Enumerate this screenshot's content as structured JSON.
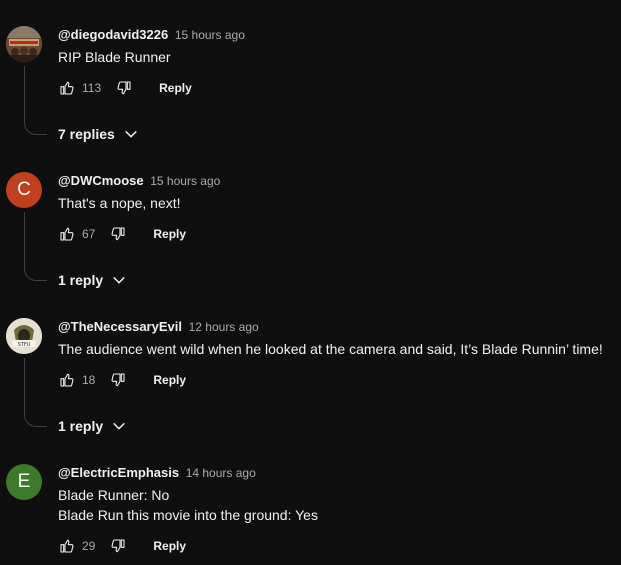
{
  "comments": [
    {
      "author": "@diegodavid3226",
      "time": "15 hours ago",
      "text_lines": [
        "RIP Blade Runner"
      ],
      "likes": "113",
      "reply_label": "Reply",
      "replies_label": "7 replies",
      "avatar_type": "image",
      "avatar_letter": ""
    },
    {
      "author": "@DWCmoose",
      "time": "15 hours ago",
      "text_lines": [
        "That's a nope, next!"
      ],
      "likes": "67",
      "reply_label": "Reply",
      "replies_label": "1 reply",
      "avatar_type": "letter",
      "avatar_letter": "C",
      "avatar_color": "#c0401f"
    },
    {
      "author": "@TheNecessaryEvil",
      "time": "12 hours ago",
      "text_lines": [
        "The audience went wild when he looked at the camera and said, It’s Blade Runnin’ time!"
      ],
      "likes": "18",
      "reply_label": "Reply",
      "replies_label": "1 reply",
      "avatar_type": "image",
      "avatar_letter": ""
    },
    {
      "author": "@ElectricEmphasis",
      "time": "14 hours ago",
      "text_lines": [
        "Blade Runner: No",
        "Blade Run this movie into the ground: Yes"
      ],
      "likes": "29",
      "reply_label": "Reply",
      "replies_label": "",
      "avatar_type": "letter",
      "avatar_letter": "E",
      "avatar_color": "#3d7a2a"
    }
  ],
  "icons": {
    "like": "thumbs-up-icon",
    "dislike": "thumbs-down-icon",
    "expand": "chevron-down-icon"
  },
  "colors": {
    "background": "#0f0f0f",
    "text": "#f1f1f1",
    "muted": "#aaaaaa"
  }
}
